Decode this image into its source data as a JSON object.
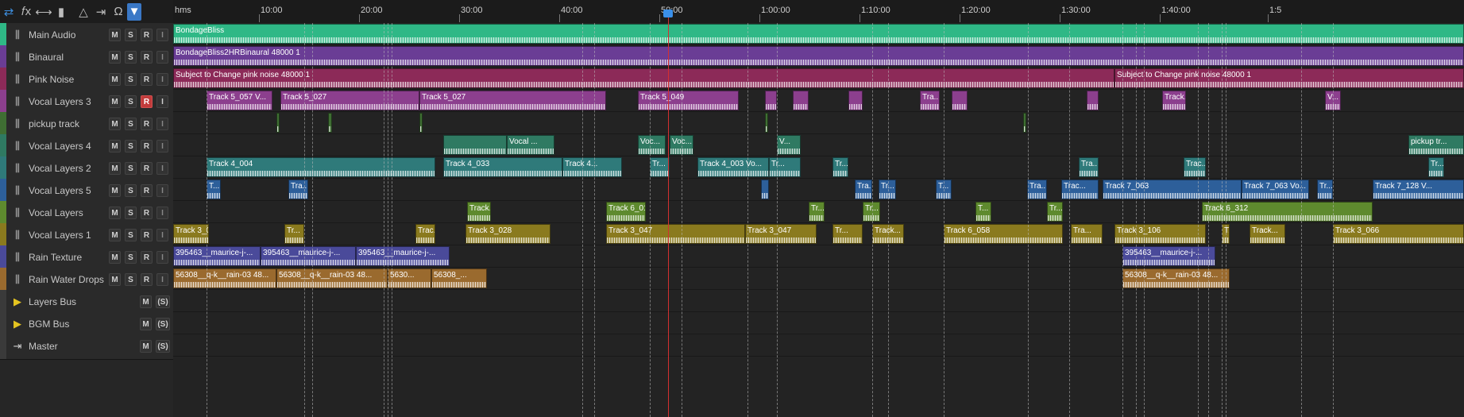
{
  "colors": {
    "accent": "#3a8fe8",
    "playhead": "#d33030",
    "record": "#c23b3b",
    "bus": "#e5c420"
  },
  "header": {
    "icons": [
      {
        "name": "swap-arrows-icon",
        "glyph": "⇄",
        "style": "blue"
      },
      {
        "name": "fx-icon",
        "glyph": "𝑓x",
        "style": ""
      },
      {
        "name": "sends-icon",
        "glyph": "⟷",
        "style": ""
      },
      {
        "name": "bars-icon",
        "glyph": "▮",
        "style": ""
      },
      {
        "name": "metronome-icon",
        "glyph": "△",
        "style": ""
      },
      {
        "name": "input-icon",
        "glyph": "⇥",
        "style": ""
      },
      {
        "name": "headphones-icon",
        "glyph": "Ω",
        "style": ""
      },
      {
        "name": "marker-icon",
        "glyph": "▼",
        "style": "active"
      }
    ]
  },
  "ruler": {
    "labels": [
      "hms",
      "10:00",
      "20:00",
      "30:00",
      "40:00",
      "50:00",
      "1:00:00",
      "1:10:00",
      "1:20:00",
      "1:30:00",
      "1:40:00",
      "1:5"
    ]
  },
  "tracks": [
    {
      "name": "Main Audio",
      "color": "#2fb886",
      "type": "audio",
      "record": false,
      "clips": [
        {
          "start": 0,
          "end": 1625,
          "label": "BondageBliss"
        }
      ]
    },
    {
      "name": "Binaural",
      "color": "#6a3d95",
      "type": "audio",
      "record": false,
      "clips": [
        {
          "start": 0,
          "end": 1625,
          "label": "BondageBliss2HRBinaural 48000 1"
        }
      ]
    },
    {
      "name": "Pink Noise",
      "color": "#8c2a58",
      "type": "audio",
      "record": false,
      "clips": [
        {
          "start": 0,
          "end": 1185,
          "label": "Subject to Change pink noise 48000 1"
        },
        {
          "start": 1185,
          "end": 1625,
          "label": "Subject to Change pink noise 48000 1"
        }
      ]
    },
    {
      "name": "Vocal Layers 3",
      "color": "#8c3f8e",
      "type": "audio",
      "record": true,
      "clips": [
        {
          "start": 42,
          "end": 125,
          "label": "Track 5_057 V..."
        },
        {
          "start": 135,
          "end": 310,
          "label": "Track 5_027"
        },
        {
          "start": 310,
          "end": 545,
          "label": "Track 5_027"
        },
        {
          "start": 585,
          "end": 712,
          "label": "Track 5_049"
        },
        {
          "start": 745,
          "end": 760,
          "label": ""
        },
        {
          "start": 780,
          "end": 800,
          "label": ""
        },
        {
          "start": 850,
          "end": 868,
          "label": ""
        },
        {
          "start": 940,
          "end": 965,
          "label": "Tra..."
        },
        {
          "start": 980,
          "end": 1000,
          "label": ""
        },
        {
          "start": 1150,
          "end": 1165,
          "label": ""
        },
        {
          "start": 1245,
          "end": 1275,
          "label": "Track..."
        },
        {
          "start": 1450,
          "end": 1470,
          "label": "V..."
        }
      ]
    },
    {
      "name": "pickup track",
      "color": "#3f6e33",
      "type": "audio",
      "record": false,
      "clips": [
        {
          "start": 130,
          "end": 134,
          "label": ""
        },
        {
          "start": 195,
          "end": 200,
          "label": ""
        },
        {
          "start": 310,
          "end": 314,
          "label": ""
        },
        {
          "start": 745,
          "end": 749,
          "label": ""
        },
        {
          "start": 1070,
          "end": 1074,
          "label": ""
        }
      ]
    },
    {
      "name": "Vocal Layers 4",
      "color": "#2f7a62",
      "type": "audio",
      "record": false,
      "clips": [
        {
          "start": 340,
          "end": 420,
          "label": ""
        },
        {
          "start": 420,
          "end": 480,
          "label": "Vocal ..."
        },
        {
          "start": 585,
          "end": 620,
          "label": "Voc..."
        },
        {
          "start": 625,
          "end": 655,
          "label": "Voc..."
        },
        {
          "start": 760,
          "end": 790,
          "label": "V..."
        },
        {
          "start": 1555,
          "end": 1625,
          "label": "pickup tr..."
        }
      ]
    },
    {
      "name": "Vocal Layers 2",
      "color": "#2f7a7a",
      "type": "audio",
      "record": false,
      "clips": [
        {
          "start": 42,
          "end": 330,
          "label": "Track 4_004"
        },
        {
          "start": 340,
          "end": 490,
          "label": "Track 4_033"
        },
        {
          "start": 490,
          "end": 565,
          "label": "Track 4..."
        },
        {
          "start": 600,
          "end": 625,
          "label": "Tr..."
        },
        {
          "start": 660,
          "end": 750,
          "label": "Track 4_003 Vo..."
        },
        {
          "start": 750,
          "end": 790,
          "label": "Tr..."
        },
        {
          "start": 830,
          "end": 850,
          "label": "Tr..."
        },
        {
          "start": 1140,
          "end": 1165,
          "label": "Tra..."
        },
        {
          "start": 1272,
          "end": 1300,
          "label": "Trac..."
        },
        {
          "start": 1580,
          "end": 1600,
          "label": "Tr..."
        }
      ]
    },
    {
      "name": "Vocal Layers 5",
      "color": "#2d5f9a",
      "type": "audio",
      "record": false,
      "clips": [
        {
          "start": 42,
          "end": 60,
          "label": "T..."
        },
        {
          "start": 145,
          "end": 170,
          "label": "Tra..."
        },
        {
          "start": 740,
          "end": 750,
          "label": ""
        },
        {
          "start": 858,
          "end": 880,
          "label": "Tra..."
        },
        {
          "start": 888,
          "end": 910,
          "label": "Tr..."
        },
        {
          "start": 960,
          "end": 980,
          "label": "T..."
        },
        {
          "start": 1075,
          "end": 1100,
          "label": "Tra..."
        },
        {
          "start": 1118,
          "end": 1165,
          "label": "Trac..."
        },
        {
          "start": 1170,
          "end": 1345,
          "label": "Track 7_063"
        },
        {
          "start": 1345,
          "end": 1430,
          "label": "Track 7_063 Vo..."
        },
        {
          "start": 1440,
          "end": 1460,
          "label": "Tr..."
        },
        {
          "start": 1510,
          "end": 1625,
          "label": "Track 7_128 V..."
        }
      ]
    },
    {
      "name": "Vocal Layers",
      "color": "#5e8a2e",
      "type": "audio",
      "record": false,
      "clips": [
        {
          "start": 370,
          "end": 400,
          "label": "Track..."
        },
        {
          "start": 545,
          "end": 595,
          "label": "Track 6_016"
        },
        {
          "start": 800,
          "end": 820,
          "label": "Tr..."
        },
        {
          "start": 868,
          "end": 890,
          "label": "Tr..."
        },
        {
          "start": 1010,
          "end": 1030,
          "label": "T..."
        },
        {
          "start": 1100,
          "end": 1120,
          "label": "Tr..."
        },
        {
          "start": 1295,
          "end": 1510,
          "label": "Track 6_312"
        }
      ]
    },
    {
      "name": "Vocal Layers 1",
      "color": "#8a7a1e",
      "type": "audio",
      "record": false,
      "clips": [
        {
          "start": 0,
          "end": 45,
          "label": "Track 3_0..."
        },
        {
          "start": 140,
          "end": 165,
          "label": "Tr..."
        },
        {
          "start": 305,
          "end": 330,
          "label": "Trac..."
        },
        {
          "start": 368,
          "end": 475,
          "label": "Track 3_028"
        },
        {
          "start": 545,
          "end": 720,
          "label": "Track 3_047"
        },
        {
          "start": 720,
          "end": 810,
          "label": "Track 3_047"
        },
        {
          "start": 830,
          "end": 868,
          "label": "Tr..."
        },
        {
          "start": 880,
          "end": 920,
          "label": "Track..."
        },
        {
          "start": 970,
          "end": 1120,
          "label": "Track 6_058"
        },
        {
          "start": 1130,
          "end": 1170,
          "label": "Tra..."
        },
        {
          "start": 1185,
          "end": 1300,
          "label": "Track 3_106"
        },
        {
          "start": 1320,
          "end": 1330,
          "label": "T..."
        },
        {
          "start": 1355,
          "end": 1400,
          "label": "Track..."
        },
        {
          "start": 1460,
          "end": 1625,
          "label": "Track 3_066"
        }
      ]
    },
    {
      "name": "Rain Texture",
      "color": "#4a4a9a",
      "type": "audio",
      "record": false,
      "clips": [
        {
          "start": 0,
          "end": 110,
          "label": "395463__maurice-j-..."
        },
        {
          "start": 110,
          "end": 230,
          "label": "395463__maurice-j-..."
        },
        {
          "start": 230,
          "end": 348,
          "label": "395463__maurice-j-..."
        },
        {
          "start": 1195,
          "end": 1312,
          "label": "395463__maurice-j-..."
        }
      ]
    },
    {
      "name": "Rain Water Drops",
      "color": "#9a6a2e",
      "type": "audio",
      "record": false,
      "clips": [
        {
          "start": 0,
          "end": 130,
          "label": "56308__q-k__rain-03 48..."
        },
        {
          "start": 130,
          "end": 270,
          "label": "56308__q-k__rain-03 48..."
        },
        {
          "start": 270,
          "end": 325,
          "label": "5630..."
        },
        {
          "start": 325,
          "end": 395,
          "label": "56308_..."
        },
        {
          "start": 1195,
          "end": 1330,
          "label": "56308__q-k__rain-03 48..."
        }
      ]
    },
    {
      "name": "Layers Bus",
      "color": "#3a3a3a",
      "type": "bus",
      "record": false,
      "clips": []
    },
    {
      "name": "BGM Bus",
      "color": "#3a3a3a",
      "type": "bus",
      "record": false,
      "clips": []
    },
    {
      "name": "Master",
      "color": "#3a3a3a",
      "type": "master",
      "record": false,
      "clips": []
    }
  ],
  "buttons": {
    "mute": "M",
    "solo": "S",
    "record": "R",
    "input": "I",
    "bus_solo": "(S)"
  }
}
